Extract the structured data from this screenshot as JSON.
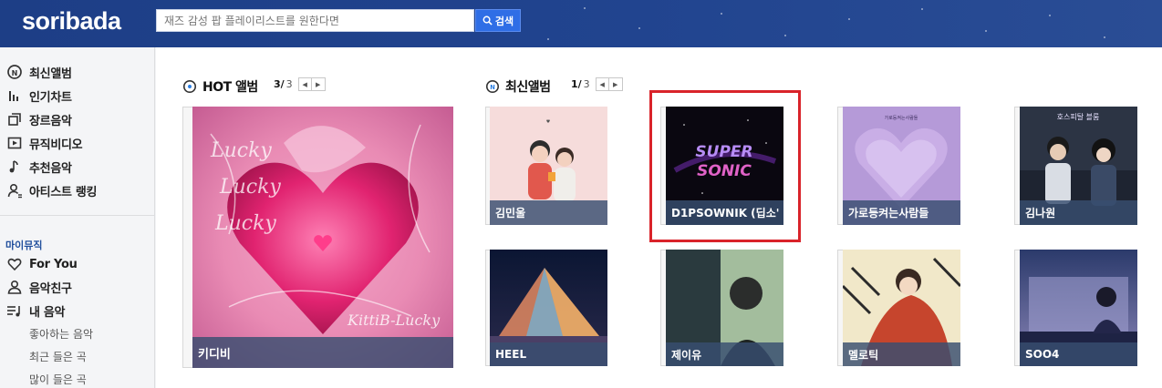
{
  "header": {
    "logo": "soribada",
    "search_placeholder": "재즈 감성 팝 플레이리스트를 원한다면",
    "search_button": "검색"
  },
  "sidebar": {
    "menu": [
      {
        "label": "최신앨범",
        "icon": "new-album-icon"
      },
      {
        "label": "인기차트",
        "icon": "chart-icon"
      },
      {
        "label": "장르음악",
        "icon": "genre-icon"
      },
      {
        "label": "뮤직비디오",
        "icon": "video-icon"
      },
      {
        "label": "추천음악",
        "icon": "music-note-icon"
      },
      {
        "label": "아티스트 랭킹",
        "icon": "artist-icon"
      }
    ],
    "my_music_label": "마이뮤직",
    "my_menu": [
      {
        "label": "For You",
        "icon": "heart-icon"
      },
      {
        "label": "음악친구",
        "icon": "friends-icon"
      },
      {
        "label": "내 음악",
        "icon": "playlist-icon"
      }
    ],
    "sub_items": [
      "좋아하는 음악",
      "최근 들은 곡",
      "많이 들은 곡"
    ]
  },
  "hot": {
    "title": "HOT 앨범",
    "page_current": "3/",
    "page_total": "3",
    "album": {
      "artist": "키디비"
    }
  },
  "latest": {
    "title": "최신앨범",
    "page_current": "1/",
    "page_total": "3",
    "albums": [
      {
        "artist": "김민울"
      },
      {
        "artist": "D1PSOWNIK (딥소'"
      },
      {
        "artist": "가로등켜는사람들"
      },
      {
        "artist": "김나원"
      },
      {
        "artist": "HEEL"
      },
      {
        "artist": "제이유"
      },
      {
        "artist": "멜로틱"
      },
      {
        "artist": "SOO4"
      }
    ]
  }
}
